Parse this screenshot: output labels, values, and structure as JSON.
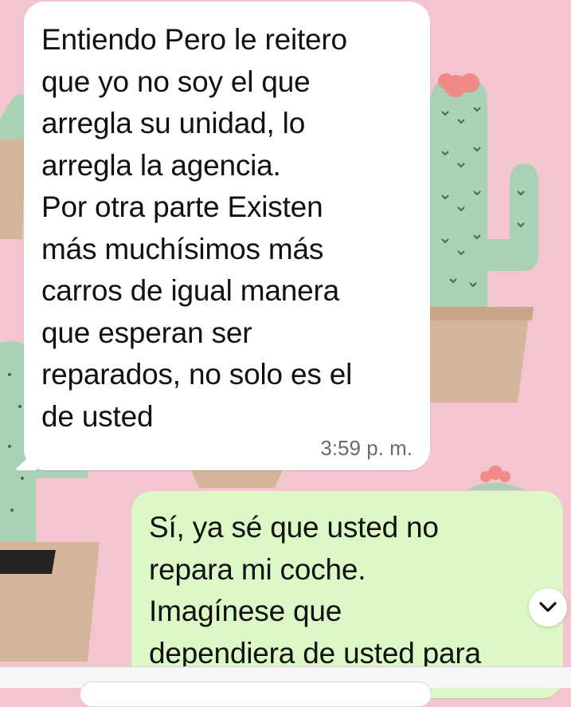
{
  "messages": [
    {
      "direction": "incoming",
      "text": "Entiendo Pero le reitero\nque yo no soy el que\narregla su unidad, lo\narregla la agencia.\nPor otra parte Existen\nmás muchísimos más\ncarros de igual manera\nque esperan ser\nreparados, no solo es el\nde usted",
      "time": "3:59 p. m."
    },
    {
      "direction": "outgoing",
      "text": "Sí, ya sé que usted no\nrepara mi coche.\nImagínese que\ndependiera de usted para"
    }
  ],
  "colors": {
    "wallpaper": "#f3c6cf",
    "incoming_bubble": "#ffffff",
    "outgoing_bubble": "#dcf8c6",
    "cactus": "#a9d1b6",
    "pot": "#d2b59a"
  },
  "icons": {
    "scroll_down": "chevron-down-icon"
  }
}
